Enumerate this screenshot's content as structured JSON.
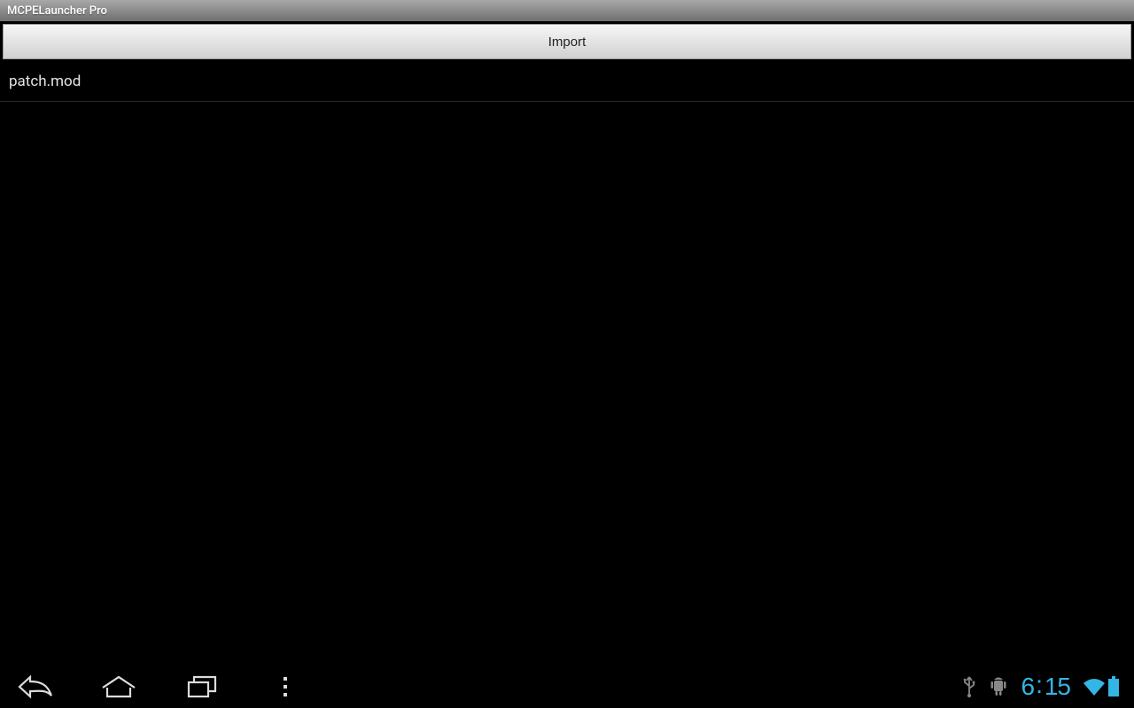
{
  "titlebar": {
    "title": "MCPELauncher Pro"
  },
  "toolbar": {
    "import_label": "Import"
  },
  "list": {
    "items": [
      {
        "label": "patch.mod"
      }
    ]
  },
  "statusbar": {
    "clock_hours": "6",
    "clock_minutes": "15"
  }
}
